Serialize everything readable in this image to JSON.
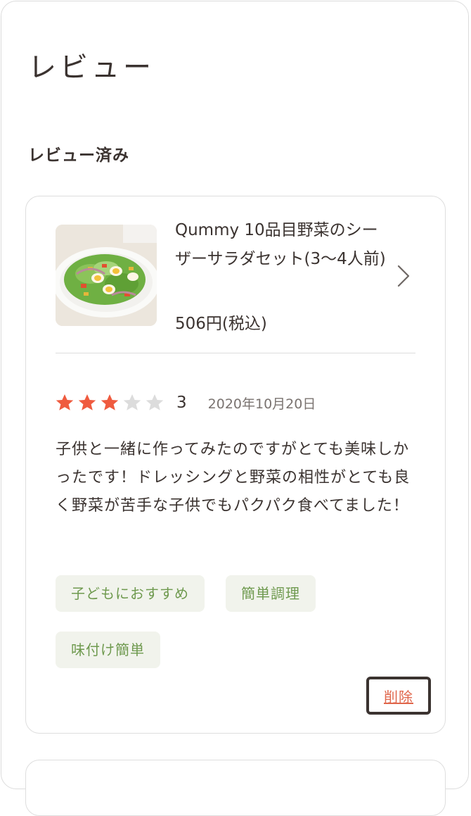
{
  "page": {
    "title": "レビュー",
    "section_title": "レビュー済み"
  },
  "review": {
    "product": {
      "name": "Qummy 10品目野菜のシーザーサラダセット(3〜4人前)",
      "price": "506円(税込)",
      "image_icon": "salad-image"
    },
    "rating": 3,
    "rating_max": 5,
    "rating_label": "3",
    "date": "2020年10月20日",
    "text": "子供と一緒に作ってみたのですがとても美味しかったです！ドレッシングと野菜の相性がとても良く野菜が苦手な子供でもパクパク食べてました！",
    "tags": [
      "子どもにおすすめ",
      "簡単調理",
      "味付け簡単"
    ],
    "delete_label": "削除"
  },
  "colors": {
    "star_filled": "#ef5b3f",
    "star_empty": "#dcdcdc",
    "tag_text": "#6f9a4f",
    "tag_bg": "#f1f3ec",
    "delete_text": "#e0664b",
    "text": "#3b3330"
  }
}
